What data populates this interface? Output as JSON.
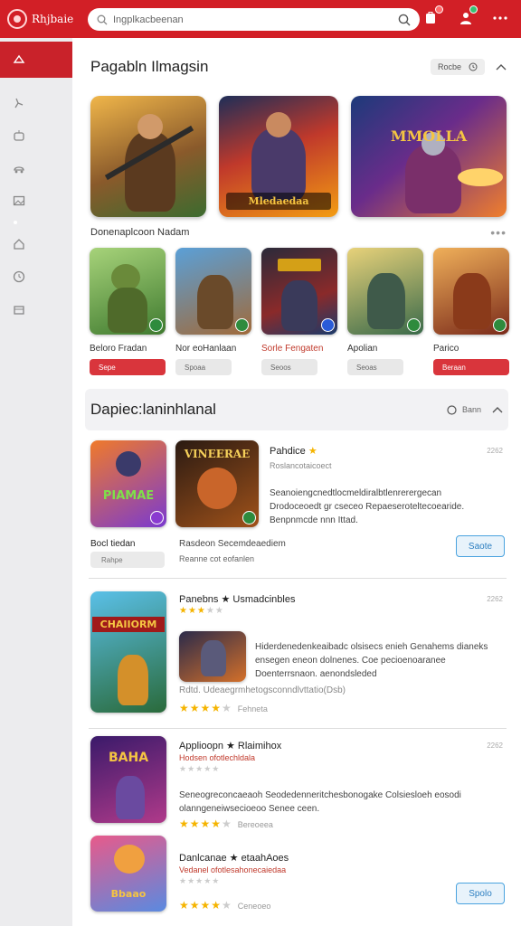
{
  "topbar": {
    "brand": "Rhjbaie",
    "search_value": "Ingplkacbeenan",
    "colors": {
      "brand": "#d21f26"
    }
  },
  "sidebar": {
    "icons": [
      "gamepad-icon",
      "person-walk-icon",
      "robot-icon",
      "car-icon",
      "image-icon",
      "home-icon",
      "clock-icon",
      "box-icon"
    ]
  },
  "section1": {
    "title": "Pagabln Ilmagsin",
    "tool_label": "Rocbe",
    "hero_labels": [
      "",
      "Mledaedaa",
      "MMOLLA"
    ],
    "sub_title": "Donenaplcoon Nadam",
    "minis": [
      {
        "name": "Beloro Fradan",
        "button": "Sepe",
        "button_style": "red"
      },
      {
        "name": "Nor eoHanlaan",
        "button": "Spoaa",
        "button_style": "grey"
      },
      {
        "name": "Sorle Fengaten",
        "button": "Seoos",
        "button_style": "grey"
      },
      {
        "name": "Apolian",
        "button": "Seoas",
        "button_style": "grey"
      },
      {
        "name": "Parico",
        "button": "Beraan",
        "button_style": "red"
      }
    ]
  },
  "section2": {
    "title": "Dapiec:laninhlanal",
    "tool_label": "Bann",
    "cards": [
      {
        "icon_text": "PIAMAE",
        "art_text": "VINEERAE",
        "title": "Pahdice",
        "date": "2262",
        "meta": "Roslancotaicoect",
        "desc": "Seanoiengcnedtlocmeldiralbtlenrerergecan Drodoceoedt gr cseceo Repaeseroteltecoearide. Benpnmcde nnn Ittad.",
        "left_name": "Bocl tiedan",
        "left_chip": "Rahpe",
        "right_name": "Rasdeon Secemdeaediem",
        "right_meta": "Reanne cot eofanlen",
        "button": "Saote"
      },
      {
        "icon_text": "CHAIIORM",
        "title": "Panebns ★ Usmadcinbles",
        "date": "2262",
        "rating": 3.5,
        "desc": "Hiderdenedenkeaibadc olsisecs enieh Genahems dianeks ensegen eneon dolnenes. Coe pecioenoaranee Doenterrsnaon. aenondsleded",
        "meta": "Rdtd. Udeaegrmhetogsconndlvttatio(Dsb)",
        "rating2": 3.5,
        "rating2_label": "Fehneta"
      },
      {
        "icon_text": "BAHA",
        "title": "Applioopn ★ Rlaimihox",
        "date": "2262",
        "meta": "Hodsen ofotlechldala",
        "desc": "Seneogreconcaeaoh Seodedenneritchesbonogake Colsiesloeh eosodi olanngeneiwsecioeoo Senee ceen.",
        "rating": 3.5,
        "rating_label": "Bereoeea"
      },
      {
        "icon_text": "Bbaao",
        "title": "Danlcanae ★ etaahAoes",
        "meta": "Vedanel ofotlesahonecaiedaa",
        "rating": 3.5,
        "rating_label": "Ceneoeo",
        "button": "Spolo"
      }
    ]
  }
}
